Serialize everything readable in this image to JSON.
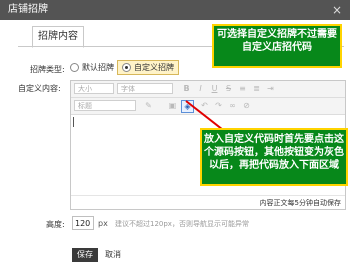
{
  "background": {
    "brand_text": "店铺"
  },
  "dialog": {
    "title": "店铺招牌",
    "close": "×"
  },
  "tabs": [
    "招牌内容"
  ],
  "form": {
    "sign_type_label": "招牌类型:",
    "radio_default": "默认招牌",
    "radio_custom": "自定义招牌",
    "custom_content_label": "自定义内容:",
    "height_label": "高度:",
    "height_value": "120",
    "height_unit": "px",
    "height_hint": "建议不超过120px，否则导航显示可能异常"
  },
  "editor": {
    "font_size_placeholder": "大小",
    "font_family_placeholder": "字体",
    "heading_placeholder": "标题",
    "status_text": "内容正文每5分钟自动保存",
    "toolbar_icons": [
      "bold-icon",
      "italic-icon",
      "underline-icon",
      "strikethrough-icon",
      "align-icon",
      "source-code-icon",
      "undo-icon",
      "redo-icon",
      "link-icon",
      "unlink-icon"
    ]
  },
  "callouts": {
    "top": "可选择自定义招牌不过需要自定义店招代码",
    "middle": "放入自定义代码时首先要点击这个源码按钮，其他按钮变为灰色以后，再把代码放入下面区域"
  },
  "buttons": {
    "save": "保存",
    "cancel": "取消"
  }
}
